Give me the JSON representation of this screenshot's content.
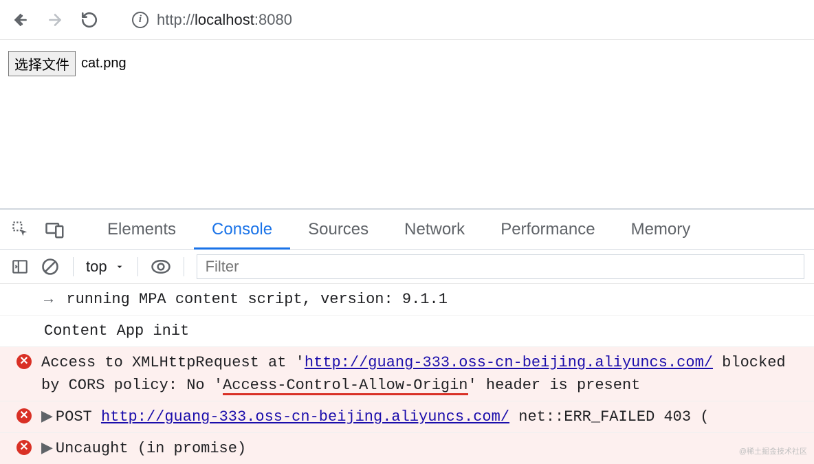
{
  "browser": {
    "url_prefix": "http://",
    "url_host": "localhost",
    "url_port": ":8080"
  },
  "page": {
    "file_button_label": "选择文件",
    "file_name": "cat.png"
  },
  "devtools": {
    "tabs": {
      "elements": "Elements",
      "console": "Console",
      "sources": "Sources",
      "network": "Network",
      "performance": "Performance",
      "memory": "Memory"
    },
    "console_toolbar": {
      "context": "top",
      "filter_placeholder": "Filter"
    },
    "messages": {
      "m1_prefix": "→ ",
      "m1": "running MPA content script, version: 9.1.1",
      "m2": "Content App init",
      "m3_a": "Access to XMLHttpRequest at '",
      "m3_link": "http://guang-333.oss-cn-beijing.aliyuncs.com/",
      "m3_b": " blocked by CORS policy: No '",
      "m3_highlight": "Access-Control-Allow-Origin",
      "m3_c": "' header is present",
      "m4_a": "POST ",
      "m4_link": "http://guang-333.oss-cn-beijing.aliyuncs.com/",
      "m4_b": " net::ERR_FAILED 403 (",
      "m5": "Uncaught (in promise)"
    }
  },
  "watermark": "@稀土掘金技术社区"
}
